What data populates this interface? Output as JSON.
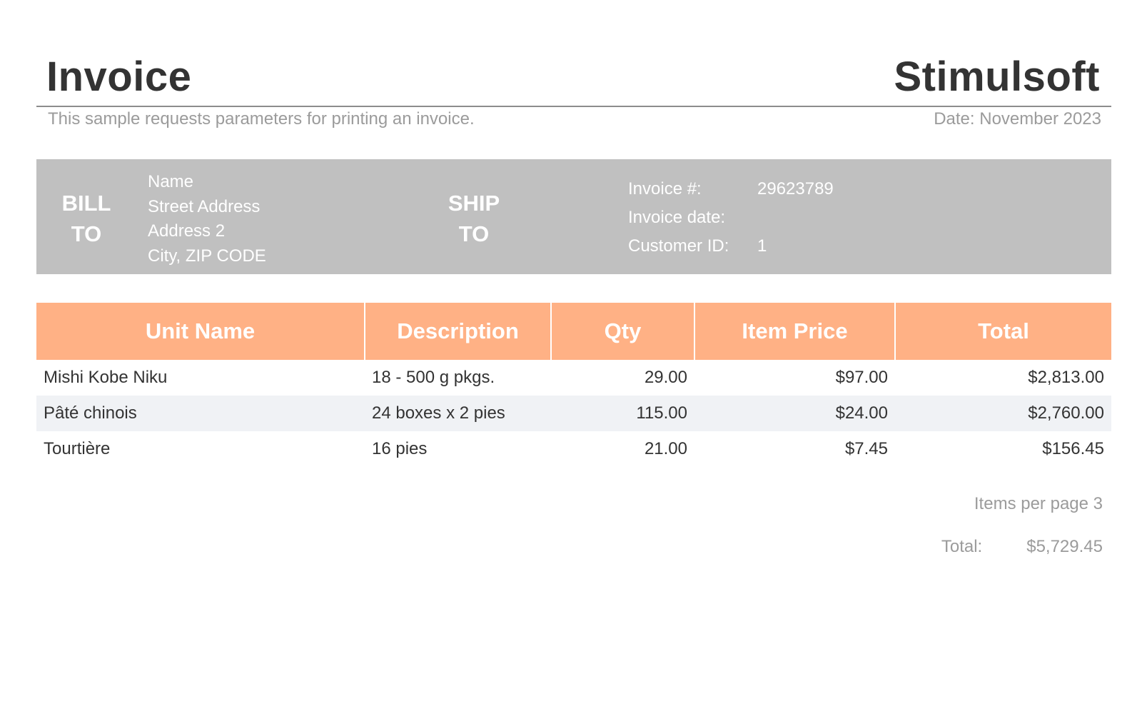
{
  "header": {
    "title": "Invoice",
    "brand": "Stimulsoft",
    "subtitle": "This sample requests parameters for printing an invoice.",
    "date": "Date: November 2023"
  },
  "bill_to": {
    "label_line1": "BILL",
    "label_line2": "TO",
    "lines": [
      "Name",
      "Street Address",
      "Address 2",
      "City,  ZIP CODE"
    ]
  },
  "ship_to": {
    "label_line1": "SHIP",
    "label_line2": "TO"
  },
  "invoice_info": [
    {
      "key": "Invoice #:",
      "value": "29623789"
    },
    {
      "key": "Invoice date:",
      "value": ""
    },
    {
      "key": "Customer ID:",
      "value": "1"
    }
  ],
  "table": {
    "columns": [
      "Unit Name",
      "Description",
      "Qty",
      "Item Price",
      "Total"
    ],
    "rows": [
      {
        "unit_name": "Mishi Kobe Niku",
        "description": "18 - 500 g pkgs.",
        "qty": "29.00",
        "item_price": "$97.00",
        "total": "$2,813.00"
      },
      {
        "unit_name": "Pâté chinois",
        "description": "24 boxes x 2 pies",
        "qty": "115.00",
        "item_price": "$24.00",
        "total": "$2,760.00"
      },
      {
        "unit_name": "Tourtière",
        "description": "16 pies",
        "qty": "21.00",
        "item_price": "$7.45",
        "total": "$156.45"
      }
    ]
  },
  "footer": {
    "items_per_page": "Items per page 3",
    "total_label": "Total:",
    "total_value": "$5,729.45"
  },
  "colors": {
    "header_fill": "#ffb185",
    "info_band": "#c0c0c0",
    "alt_row": "#f0f2f5"
  }
}
